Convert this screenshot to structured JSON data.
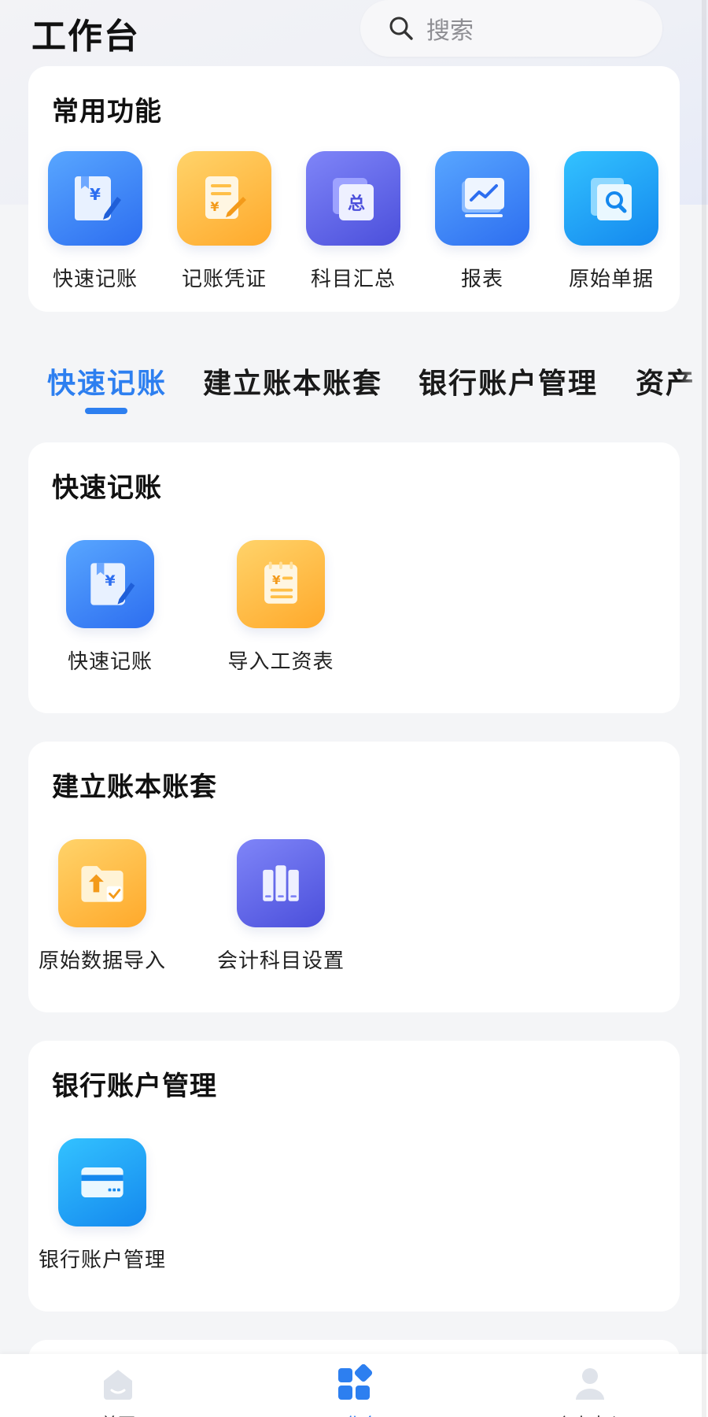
{
  "header": {
    "title": "工作台",
    "search_placeholder": "搜索"
  },
  "common": {
    "title": "常用功能",
    "items": [
      {
        "label": "快速记账",
        "icon": "quick-entry-icon"
      },
      {
        "label": "记账凭证",
        "icon": "voucher-icon"
      },
      {
        "label": "科目汇总",
        "icon": "summary-icon"
      },
      {
        "label": "报表",
        "icon": "report-icon"
      },
      {
        "label": "原始单据",
        "icon": "document-search-icon"
      }
    ]
  },
  "tabs": [
    {
      "label": "快速记账",
      "active": true
    },
    {
      "label": "建立账本账套",
      "active": false
    },
    {
      "label": "银行账户管理",
      "active": false
    },
    {
      "label": "资产",
      "active": false
    }
  ],
  "sections": [
    {
      "title": "快速记账",
      "items": [
        {
          "label": "快速记账",
          "icon": "quick-entry-icon"
        },
        {
          "label": "导入工资表",
          "icon": "import-payroll-icon"
        }
      ]
    },
    {
      "title": "建立账本账套",
      "items": [
        {
          "label": "原始数据导入",
          "icon": "folder-import-icon"
        },
        {
          "label": "会计科目设置",
          "icon": "books-icon"
        }
      ]
    },
    {
      "title": "银行账户管理",
      "items": [
        {
          "label": "银行账户管理",
          "icon": "bank-card-icon"
        }
      ]
    }
  ],
  "bottom_nav": [
    {
      "label": "首页",
      "icon": "home-icon",
      "active": false
    },
    {
      "label": "工作台",
      "icon": "workbench-icon",
      "active": true
    },
    {
      "label": "个人中心",
      "icon": "profile-icon",
      "active": false
    }
  ],
  "colors": {
    "accent": "#2d7ff0",
    "background": "#f4f5f7",
    "card": "#ffffff"
  }
}
